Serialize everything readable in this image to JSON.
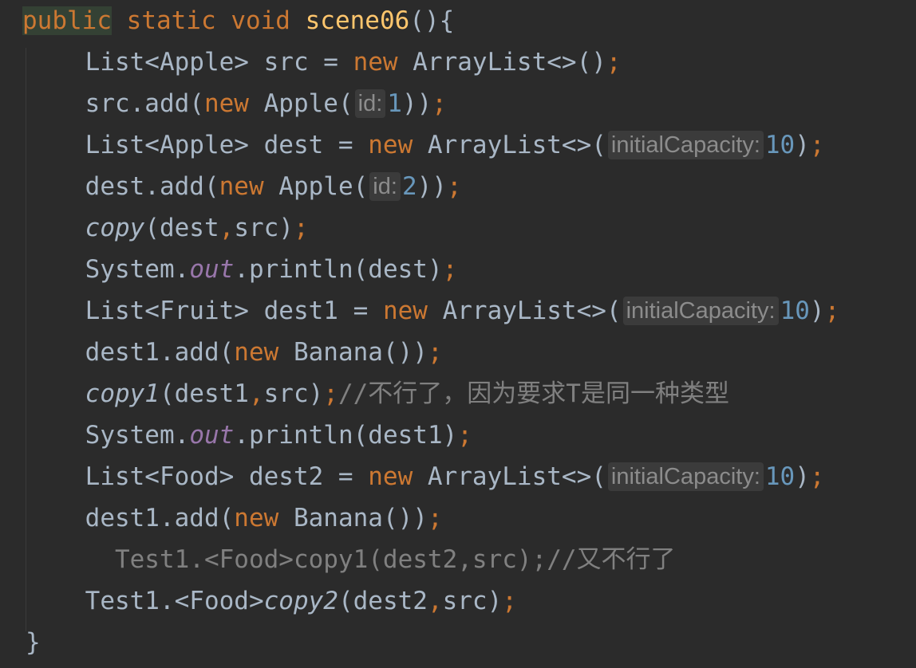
{
  "colors": {
    "background": "#2b2b2b",
    "keyword": "#cc7832",
    "method_decl": "#ffc66d",
    "number": "#6897bb",
    "static_field": "#9876aa",
    "comment": "#808080",
    "default_text": "#a9b7c6",
    "hint_background": "#3b3b3b"
  },
  "code": {
    "l1": {
      "kw_public": "public",
      "s1": " ",
      "kw_static": "static",
      "s2": " ",
      "kw_void": "void",
      "s3": " ",
      "name": "scene06",
      "rest": "(){"
    },
    "l2": {
      "a": "    List<Apple> src = ",
      "kw": "new",
      "b": " ArrayList<>()",
      "semi": ";"
    },
    "l3": {
      "a": "    src.add(",
      "kw": "new",
      "b": " Apple(",
      "hint": "id:",
      "num": "1",
      "c": "))",
      "semi": ";"
    },
    "l4": {
      "a": "    List<Apple> dest = ",
      "kw": "new",
      "b": " ArrayList<>(",
      "hint": "initialCapacity:",
      "num": "10",
      "c": ")",
      "semi": ";"
    },
    "l5": {
      "a": "    dest.add(",
      "kw": "new",
      "b": " Apple(",
      "hint": "id:",
      "num": "2",
      "c": "))",
      "semi": ";"
    },
    "l6": {
      "ital": "copy",
      "a": "(dest",
      "comma": ",",
      "b": "src)",
      "semi": ";",
      "indent": "    "
    },
    "l7": {
      "a": "    System.",
      "field": "out",
      "b": ".println(dest)",
      "semi": ";"
    },
    "l8": {
      "a": "    List<Fruit> dest1 = ",
      "kw": "new",
      "b": " ArrayList<>(",
      "hint": "initialCapacity:",
      "num": "10",
      "c": ")",
      "semi": ";"
    },
    "l9": {
      "a": "    dest1.add(",
      "kw": "new",
      "b": " Banana())",
      "semi": ";"
    },
    "l10": {
      "indent": "    ",
      "ital": "copy1",
      "a": "(dest1",
      "comma": ",",
      "b": "src)",
      "semi": ";",
      "comment": "//不行了，因为要求T是同一种类型"
    },
    "l11": {
      "a": "    System.",
      "field": "out",
      "b": ".println(dest1)",
      "semi": ";"
    },
    "l12": {
      "a": "    List<Food> dest2 = ",
      "kw": "new",
      "b": " ArrayList<>(",
      "hint": "initialCapacity:",
      "num": "10",
      "c": ")",
      "semi": ";"
    },
    "l13": {
      "a": "    dest1.add(",
      "kw": "new",
      "b": " Banana())",
      "semi": ";"
    },
    "l14": {
      "text": "      Test1.<Food>copy1(dest2,src);//又不行了"
    },
    "l15": {
      "a": "    Test1.<Food>",
      "ital": "copy2",
      "b": "(dest2",
      "comma": ",",
      "c": "src)",
      "semi": ";"
    },
    "l16": {
      "text": "}"
    }
  }
}
